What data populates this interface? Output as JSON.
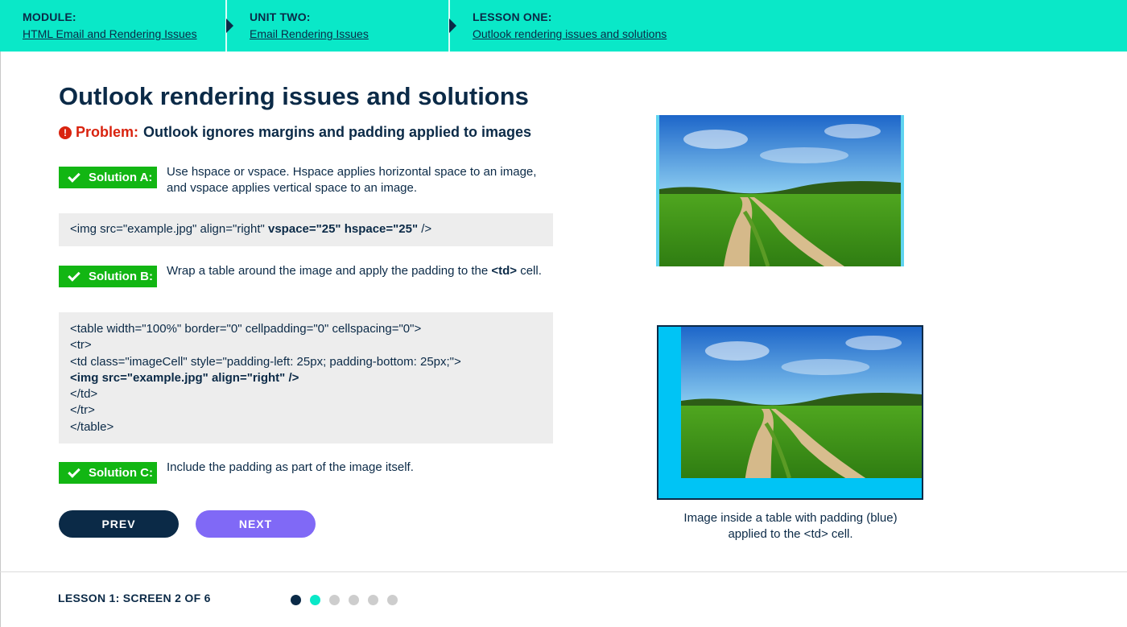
{
  "breadcrumb": [
    {
      "heading": "MODULE:",
      "link": "HTML Email and Rendering Issues"
    },
    {
      "heading": "UNIT TWO:",
      "link": "Email Rendering Issues"
    },
    {
      "heading": "LESSON ONE:",
      "link": "Outlook rendering issues and solutions"
    }
  ],
  "page": {
    "title": "Outlook rendering issues and solutions",
    "problem_label": "Problem:",
    "problem_text": "Outlook ignores margins and padding applied to images"
  },
  "solutions": {
    "a": {
      "label": "Solution A:",
      "text": "Use hspace or vspace. Hspace applies horizontal space to an image, and vspace applies vertical space to an image."
    },
    "b": {
      "label": "Solution B:",
      "text_before": "Wrap a table around the image and apply the padding to the ",
      "text_bold": "<td>",
      "text_after": " cell."
    },
    "c": {
      "label": "Solution C:",
      "text": "Include the padding as part of the image itself."
    }
  },
  "code_a": {
    "plain": "<img src=\"example.jpg\" align=\"right\" ",
    "bold": "vspace=\"25\" hspace=\"25\"",
    "end": " />"
  },
  "code_b": [
    "<table width=\"100%\" border=\"0\" cellpadding=\"0\" cellspacing=\"0\">",
    "<tr>",
    "<td class=\"imageCell\" style=\"padding-left: 25px; padding-bottom: 25px;\">",
    "<img src=\"example.jpg\" align=\"right\" />",
    "</td>",
    "</tr>",
    "</table>"
  ],
  "nav": {
    "prev_label": "PREV",
    "next_label": "NEXT"
  },
  "figure": {
    "caption_line1": "Image inside a table with padding (blue)",
    "caption_line2": "applied to the <td> cell.",
    "padding_color": "#00c4f5"
  },
  "footer": {
    "progress_text": "LESSON 1: SCREEN 2 OF 6",
    "total_screens": 6,
    "current_screen": 2
  },
  "colors": {
    "accent": "#0ae8c8",
    "navy": "#0b2a47",
    "problem_red": "#d9230f",
    "solution_green": "#12b613",
    "next_purple": "#8069f6"
  }
}
